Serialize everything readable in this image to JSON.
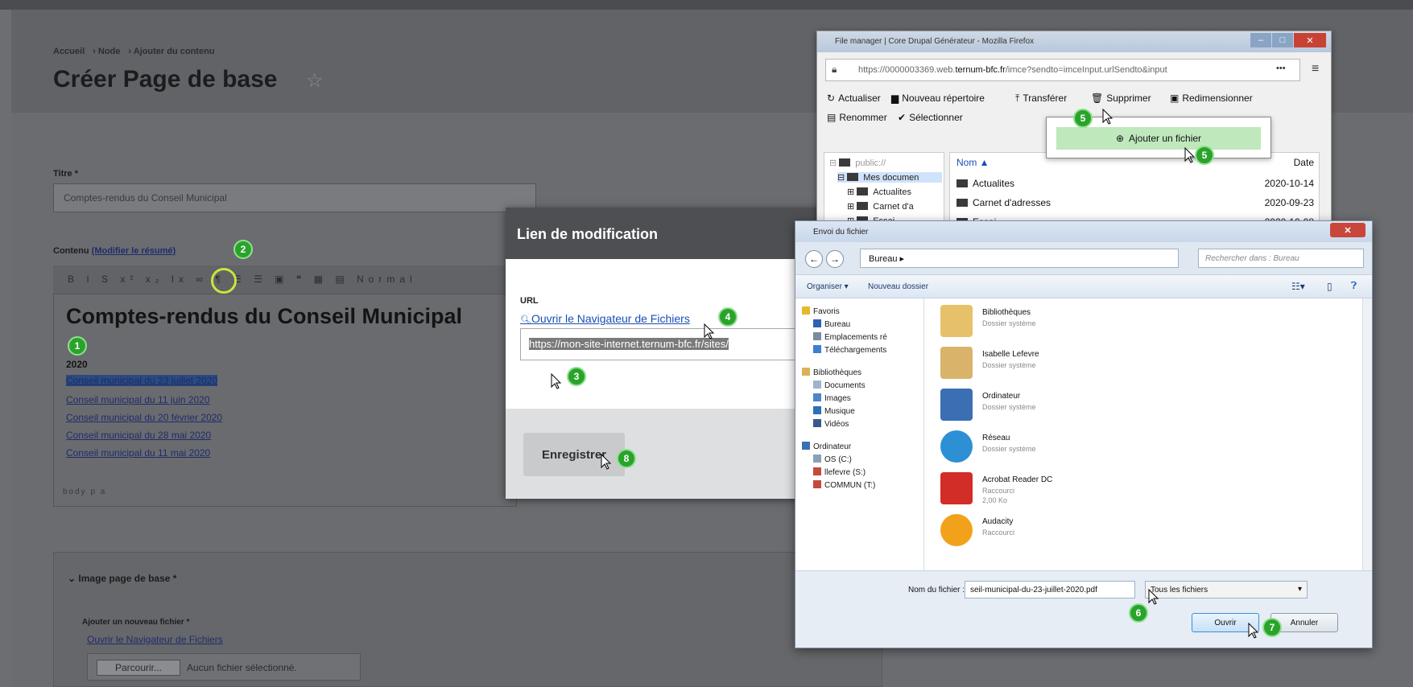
{
  "breadcrumb": [
    "Accueil",
    "Node",
    "Ajouter du contenu"
  ],
  "page_title": "Créer Page de base",
  "title_field": {
    "label": "Titre *",
    "value": "Comptes-rendus du Conseil Municipal"
  },
  "content_field": {
    "label": "Contenu",
    "summary_link": "(Modifier le résumé)",
    "toolbar_text": "B I S x² x₂ Ix ∞ ¶ ☰ ☰ ▣ ❝ ▦ ▤ Normal",
    "heading": "Comptes-rendus du Conseil Municipal",
    "year": "2020",
    "links": [
      "Conseil municipal du 23 juillet 2020",
      "Conseil municipal du 11 juin 2020",
      "Conseil municipal du 20 février 2020",
      "Conseil municipal du 28 mai 2020",
      "Conseil municipal du 11 mai 2020"
    ],
    "footer": "body p a"
  },
  "image_section": {
    "title": "Image page de base *",
    "add_label": "Ajouter un nouveau fichier *",
    "browse_link": "Ouvrir le Navigateur de Fichiers",
    "browse_button": "Parcourir...",
    "no_file": "Aucun fichier sélectionné."
  },
  "modal": {
    "title": "Lien de modification",
    "url_label": "URL",
    "browser_link": "Ouvrir le Navigateur de Fichiers",
    "url_value": "https://mon-site-internet.ternum-bfc.fr/sites/",
    "save_button": "Enregistrer"
  },
  "file_manager": {
    "window_title": "File manager | Core Drupal Générateur - Mozilla Firefox",
    "url_prefix": "https://0000003369.web.",
    "url_domain": "ternum-bfc.fr",
    "url_suffix": "/imce?sendto=imceInput.urlSendto&input",
    "url_more": "•••",
    "toolbar": {
      "refresh": "Actualiser",
      "new_folder": "Nouveau répertoire",
      "upload": "Transférer",
      "delete": "Supprimer",
      "resize": "Redimensionner",
      "rename": "Renommer",
      "select": "Sélectionner"
    },
    "popup_add": "Ajouter un fichier",
    "tree": [
      "public://",
      "Mes documen",
      "Actualites",
      "Carnet d'a",
      "Essai"
    ],
    "columns": {
      "name": "Nom ▲",
      "date": "Date"
    },
    "rows": [
      {
        "name": "Actualites",
        "date": "2020-10-14"
      },
      {
        "name": "Carnet d'adresses",
        "date": "2020-09-23"
      },
      {
        "name": "Essai",
        "date": "2020-10-08"
      }
    ]
  },
  "open_dialog": {
    "title": "Envoi du fichier",
    "address": "Bureau ▸",
    "search_placeholder": "Rechercher dans : Bureau",
    "organize": "Organiser ▾",
    "new_folder": "Nouveau dossier",
    "nav": {
      "favorites": "Favoris",
      "desktop": "Bureau",
      "recent": "Emplacements ré",
      "downloads": "Téléchargements",
      "libraries": "Bibliothèques",
      "documents": "Documents",
      "images": "Images",
      "music": "Musique",
      "videos": "Vidéos",
      "computer": "Ordinateur",
      "os": "OS (C:)",
      "lefevre": "llefevre (S:)",
      "commun": "COMMUN (T:)"
    },
    "items": [
      {
        "name": "Bibliothèques",
        "sub": "Dossier système",
        "color": "#e6c16a"
      },
      {
        "name": "Isabelle Lefevre",
        "sub": "Dossier système",
        "color": "#d9b36a"
      },
      {
        "name": "Ordinateur",
        "sub": "Dossier système",
        "color": "#3b6fb3"
      },
      {
        "name": "Réseau",
        "sub": "Dossier système",
        "color": "#2d8fd4"
      },
      {
        "name": "Acrobat Reader DC",
        "sub": "Raccourci",
        "sub2": "2,00 Ko",
        "color": "#d32d27"
      },
      {
        "name": "Audacity",
        "sub": "Raccourci",
        "color": "#f2a21a"
      }
    ],
    "filename_label": "Nom du fichier :",
    "filename_value": "seil-municipal-du-23-juillet-2020.pdf",
    "filetype": "Tous les fichiers",
    "open_button": "Ouvrir",
    "cancel_button": "Annuler"
  },
  "steps": [
    "1",
    "2",
    "3",
    "4",
    "5",
    "5",
    "6",
    "7",
    "8"
  ],
  "colors": {
    "badge": "#2aa32a",
    "highlight_circle": "#c8e63c",
    "cursor_halo": "#f5b300"
  }
}
